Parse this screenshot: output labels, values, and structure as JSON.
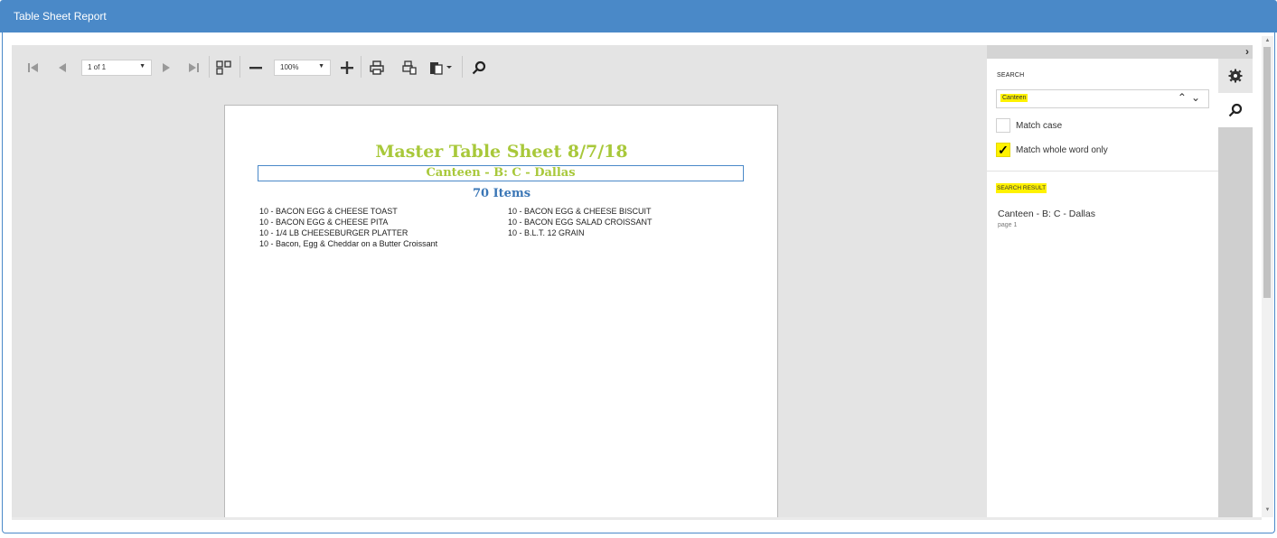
{
  "window": {
    "title": "Table Sheet Report"
  },
  "toolbar": {
    "page_select": "1 of 1",
    "zoom_select": "100%"
  },
  "report": {
    "title": "Master Table Sheet  8/7/18",
    "subtitle": "Canteen - B: C - Dallas",
    "count": "70 Items",
    "items_left": [
      "10 - BACON EGG & CHEESE TOAST",
      "10 - BACON EGG & CHEESE PITA",
      "10 - 1/4 LB CHEESEBURGER PLATTER",
      "10 - Bacon, Egg & Cheddar on a Butter Croissant"
    ],
    "items_right": [
      "10 - BACON EGG & CHEESE BISCUIT",
      "10 - BACON  EGG SALAD CROISSANT",
      "10 - B.L.T. 12 GRAIN"
    ]
  },
  "search_panel": {
    "heading": "SEARCH",
    "query": "Canteen",
    "match_case_label": "Match case",
    "match_case_checked": false,
    "whole_word_label": "Match whole word only",
    "whole_word_checked": true,
    "results_heading": "SEARCH RESULT",
    "results": [
      {
        "text": "Canteen - B: C - Dallas",
        "page": "page 1"
      }
    ]
  },
  "colors": {
    "header": "#4a89c8",
    "report_green": "#a8c83a",
    "report_blue": "#3a76b6",
    "highlight": "#fff200"
  }
}
